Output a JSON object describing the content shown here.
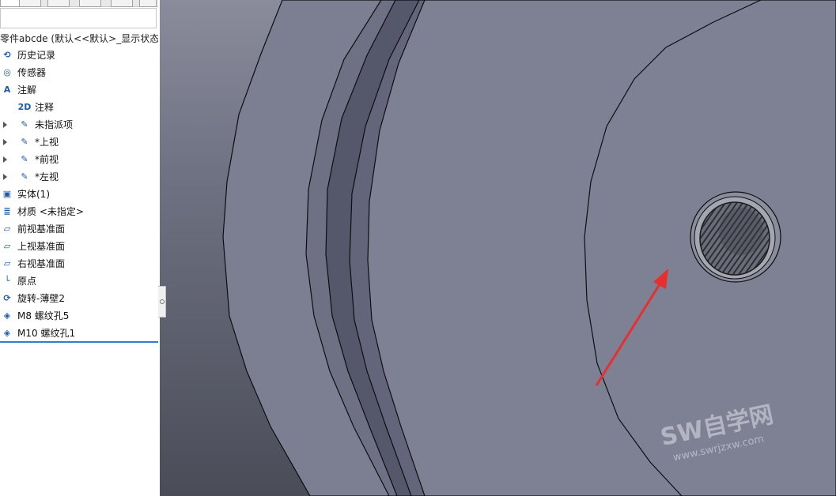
{
  "feature_tree": {
    "root_label": "零件abcde  (默认<<默认>_显示状态",
    "items": [
      {
        "label": "历史记录",
        "icon": "history-icon"
      },
      {
        "label": "传感器",
        "icon": "sensor-icon"
      },
      {
        "label": "注解",
        "icon": "annotations-icon"
      },
      {
        "label": "注释",
        "icon": "note-2d-icon"
      },
      {
        "label": "未指派项",
        "icon": "view-annotation-icon"
      },
      {
        "label": "*上视",
        "icon": "view-annotation-icon"
      },
      {
        "label": "*前视",
        "icon": "view-annotation-icon"
      },
      {
        "label": "*左视",
        "icon": "view-annotation-icon"
      },
      {
        "label": "实体(1)",
        "icon": "solid-bodies-icon"
      },
      {
        "label": "材质 <未指定>",
        "icon": "material-icon"
      },
      {
        "label": "前视基准面",
        "icon": "plane-icon"
      },
      {
        "label": "上视基准面",
        "icon": "plane-icon"
      },
      {
        "label": "右视基准面",
        "icon": "plane-icon"
      },
      {
        "label": "原点",
        "icon": "origin-icon"
      },
      {
        "label": "旋转-薄壁2",
        "icon": "revolve-icon"
      },
      {
        "label": "M8 螺纹孔5",
        "icon": "hole-wizard-icon"
      },
      {
        "label": "M10 螺纹孔1",
        "icon": "hole-wizard-icon"
      }
    ]
  },
  "watermark": {
    "title": "SW自学网",
    "url": "www.swrjzxw.com"
  },
  "colors": {
    "model_face": "#7e8194",
    "model_dark": "#5e6070",
    "viewport_bg": "#4f525e",
    "edge": "#0d0d10",
    "annotation_arrow": "#e53030",
    "selection": "#2a7fd4"
  }
}
